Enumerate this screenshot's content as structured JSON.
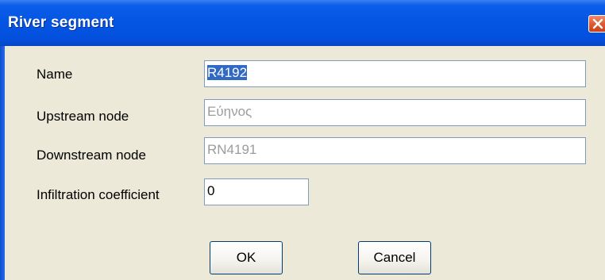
{
  "window": {
    "title": "River segment"
  },
  "form": {
    "name_label": "Name",
    "name_value": "R4192",
    "upstream_label": "Upstream node",
    "upstream_value": "Εύηνος",
    "downstream_label": "Downstream node",
    "downstream_value": "RN4191",
    "infiltration_label": "Infiltration coefficient",
    "infiltration_value": "0"
  },
  "buttons": {
    "ok_label": "OK",
    "cancel_label": "Cancel"
  },
  "icons": {
    "close": "close-icon"
  },
  "colors": {
    "titlebar": "#0554e3",
    "dialog_bg": "#ece9d8",
    "selection": "#316ac5",
    "close_button": "#e25b2f",
    "disabled_text": "#9c9c9c"
  }
}
